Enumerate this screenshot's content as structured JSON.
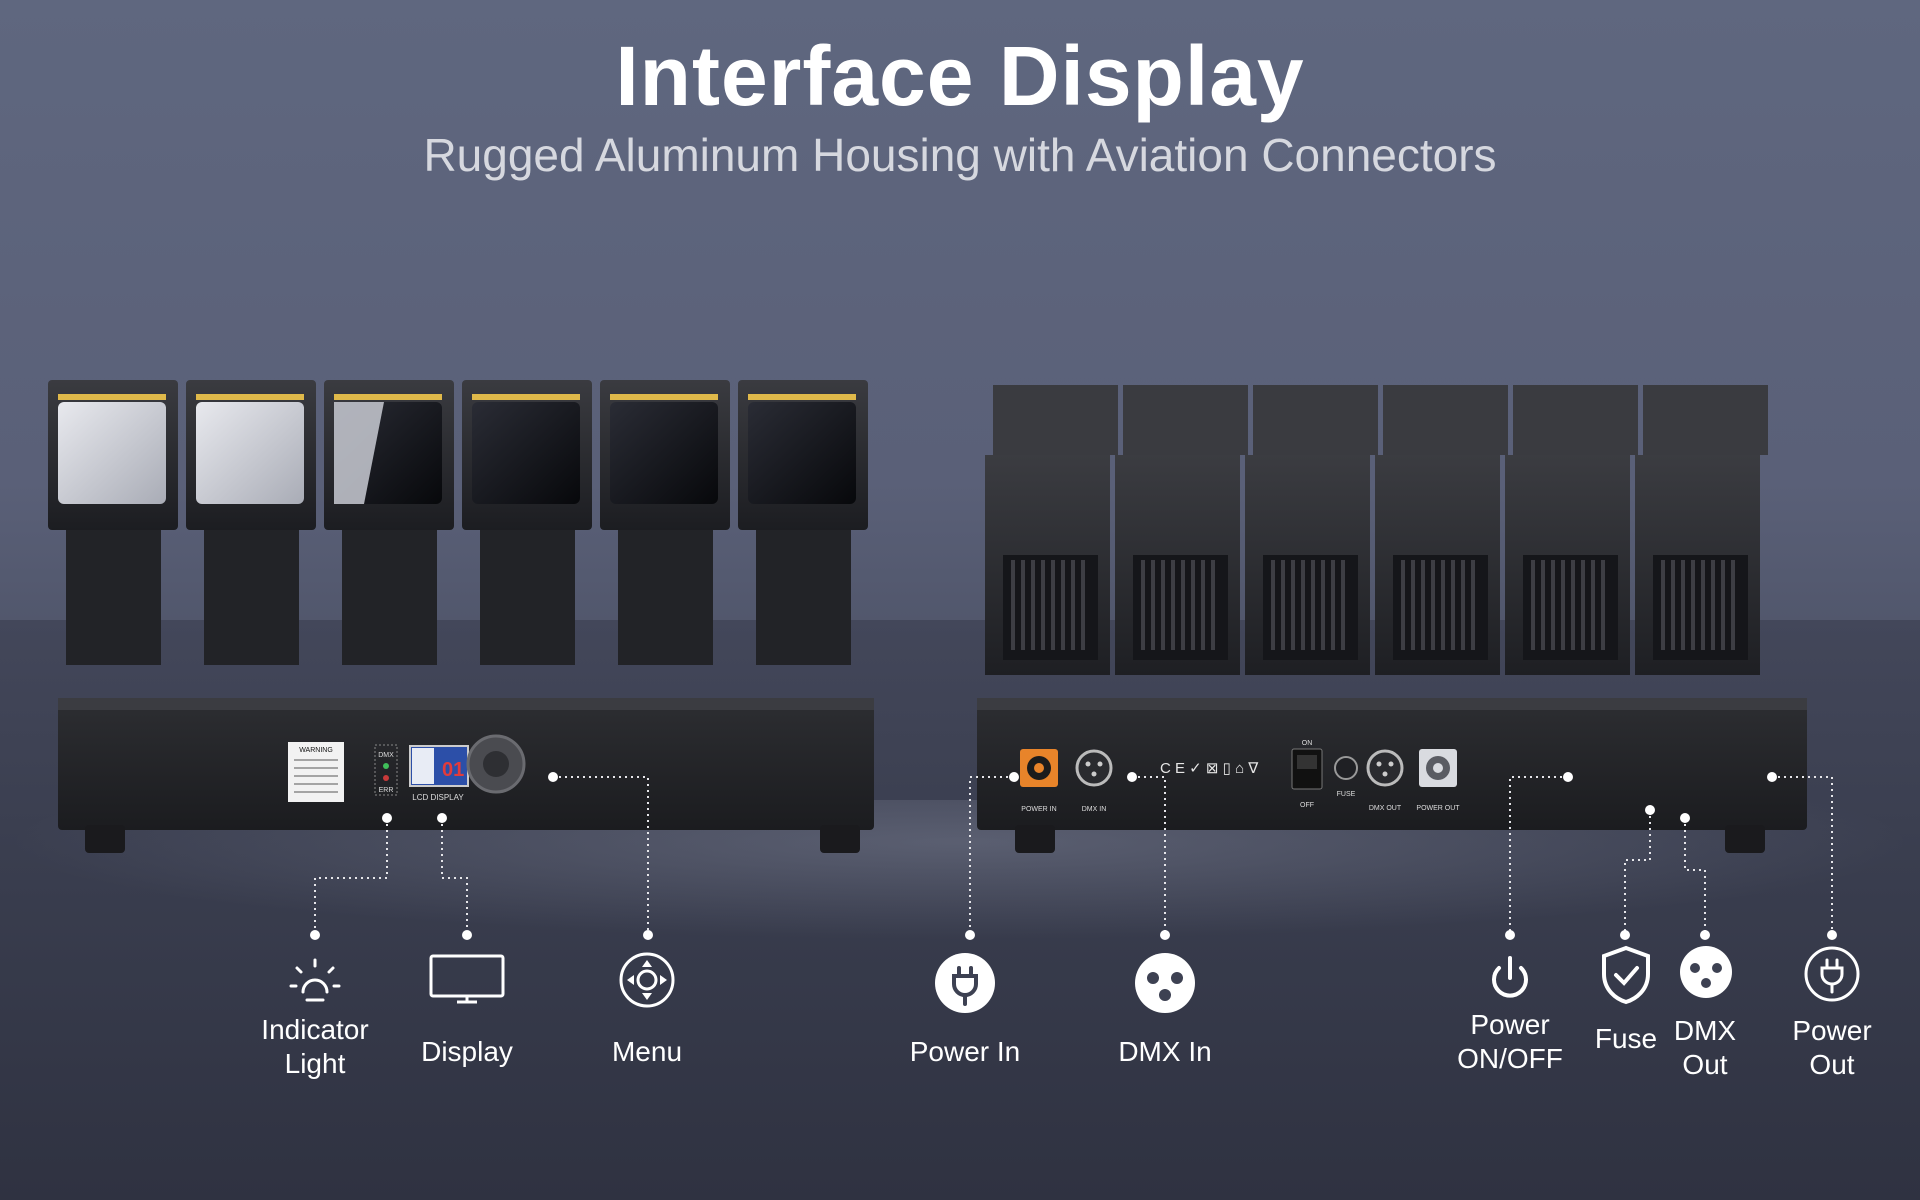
{
  "header": {
    "title": "Interface Display",
    "subtitle": "Rugged Aluminum Housing with Aviation Connectors"
  },
  "front_panel": {
    "warning_label": "WARNING",
    "led_dmx": "DMX",
    "led_err": "ERR",
    "lcd_value": "01",
    "lcd_caption": "LCD DISPLAY"
  },
  "rear_panel": {
    "power_in_port": "POWER IN",
    "dmx_in_port": "DMX IN",
    "switch_on": "ON",
    "switch_off": "OFF",
    "fuse_port": "FUSE",
    "dmx_out_port": "DMX OUT",
    "power_out_port": "POWER OUT"
  },
  "callouts": {
    "indicator_light": [
      "Indicator",
      "Light"
    ],
    "display": "Display",
    "menu": "Menu",
    "power_in": "Power In",
    "dmx_in": "DMX In",
    "power_onoff": [
      "Power",
      "ON/OFF"
    ],
    "fuse": "Fuse",
    "dmx_out": [
      "DMX",
      "Out"
    ],
    "power_out": [
      "Power",
      "Out"
    ]
  },
  "icons": [
    "light-bulb-icon",
    "monitor-icon",
    "menu-dpad-icon",
    "power-plug-icon",
    "xlr-connector-icon",
    "power-button-icon",
    "shield-check-icon",
    "xlr-connector-icon",
    "power-plug-outline-icon"
  ],
  "colors": {
    "background": "#5f677f",
    "text": "#ffffff",
    "accent_orange": "#e8842a",
    "lcd_blue": "#2c4fa8"
  }
}
